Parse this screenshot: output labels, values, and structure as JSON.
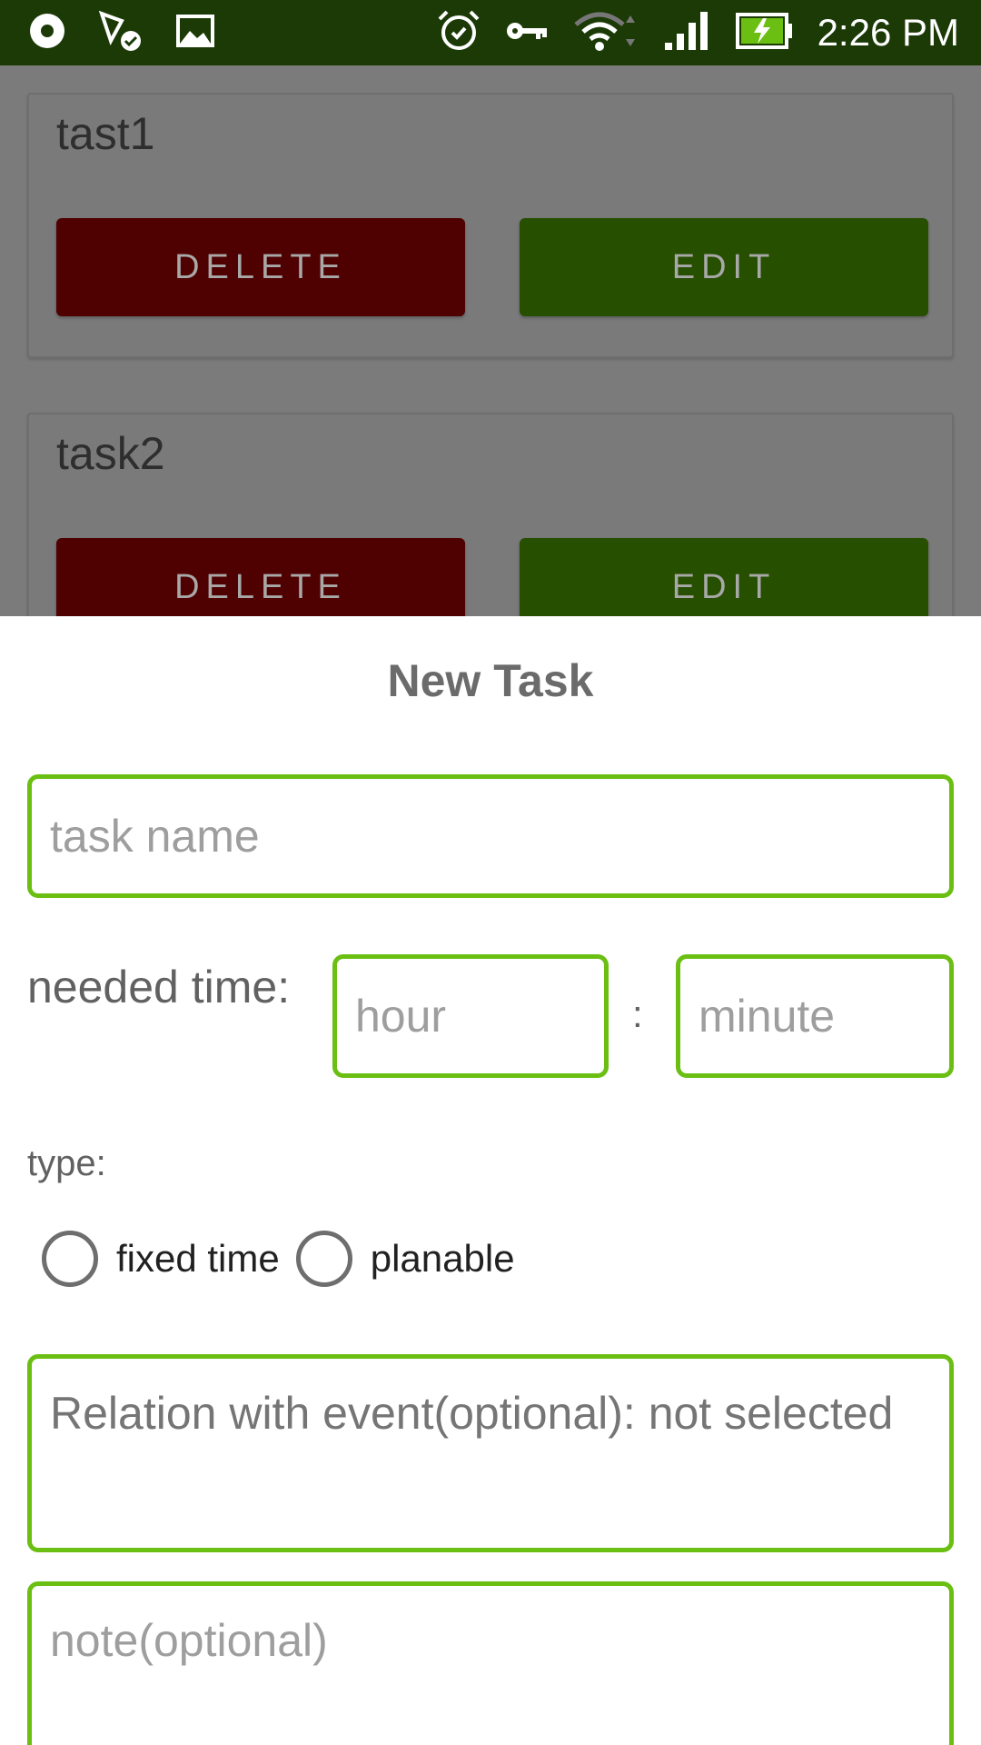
{
  "status_bar": {
    "time": "2:26 PM",
    "left_icons": [
      "record-icon",
      "signal-check-icon",
      "image-icon"
    ],
    "right_icons": [
      "alarm-icon",
      "key-icon",
      "wifi-icon",
      "cell-signal-icon",
      "battery-charging-icon"
    ]
  },
  "tasks": [
    {
      "title": "tast1",
      "delete_label": "DELETE",
      "edit_label": "EDIT"
    },
    {
      "title": "task2",
      "delete_label": "DELETE",
      "edit_label": "EDIT"
    }
  ],
  "dialog": {
    "title": "New Task",
    "task_name_placeholder": "task name",
    "needed_time_label": "needed time:",
    "hour_placeholder": "hour",
    "separator": ":",
    "minute_placeholder": "minute",
    "type_label": "type:",
    "radio_fixed": "fixed time",
    "radio_planable": "planable",
    "relation_text": "Relation with event(optional): not selected",
    "note_placeholder": "note(optional)"
  },
  "colors": {
    "status_bar": "#1b3a06",
    "accent_green": "#6abf12",
    "delete_red": "#4f0000",
    "edit_green": "#264f00"
  }
}
